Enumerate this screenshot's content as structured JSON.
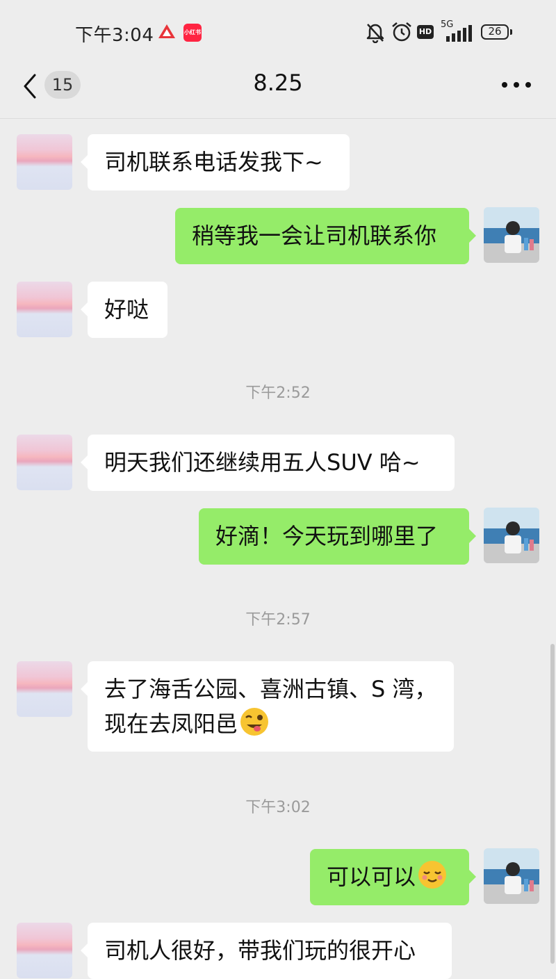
{
  "status_bar": {
    "time": "下午3:04",
    "app_icon_label": "小红书",
    "network": "5G",
    "hd": "HD",
    "battery": "26"
  },
  "nav": {
    "unread_count": "15",
    "title": "8.25"
  },
  "messages": [
    {
      "side": "in",
      "text": "司机联系电话发我下~"
    },
    {
      "side": "out",
      "text": "稍等我一会让司机联系你"
    },
    {
      "side": "in",
      "text": "好哒"
    },
    {
      "timestamp": "下午2:52"
    },
    {
      "side": "in",
      "text": "明天我们还继续用五人SUV 哈~"
    },
    {
      "side": "out",
      "text": "好滴！今天玩到哪里了"
    },
    {
      "timestamp": "下午2:57"
    },
    {
      "side": "in",
      "line1": "去了海舌公园、喜洲古镇、S 湾，",
      "line2": "现在去凤阳邑",
      "emoji": "wink-tongue"
    },
    {
      "timestamp": "下午3:02"
    },
    {
      "side": "out",
      "text": "可以可以",
      "emoji": "smiling-face"
    },
    {
      "side": "in",
      "text": "司机人很好，带我们玩的很开心"
    }
  ],
  "colors": {
    "background": "#ededed",
    "incoming_bubble": "#ffffff",
    "outgoing_bubble": "#95ec69",
    "timestamp_text": "#9a9a9a"
  }
}
